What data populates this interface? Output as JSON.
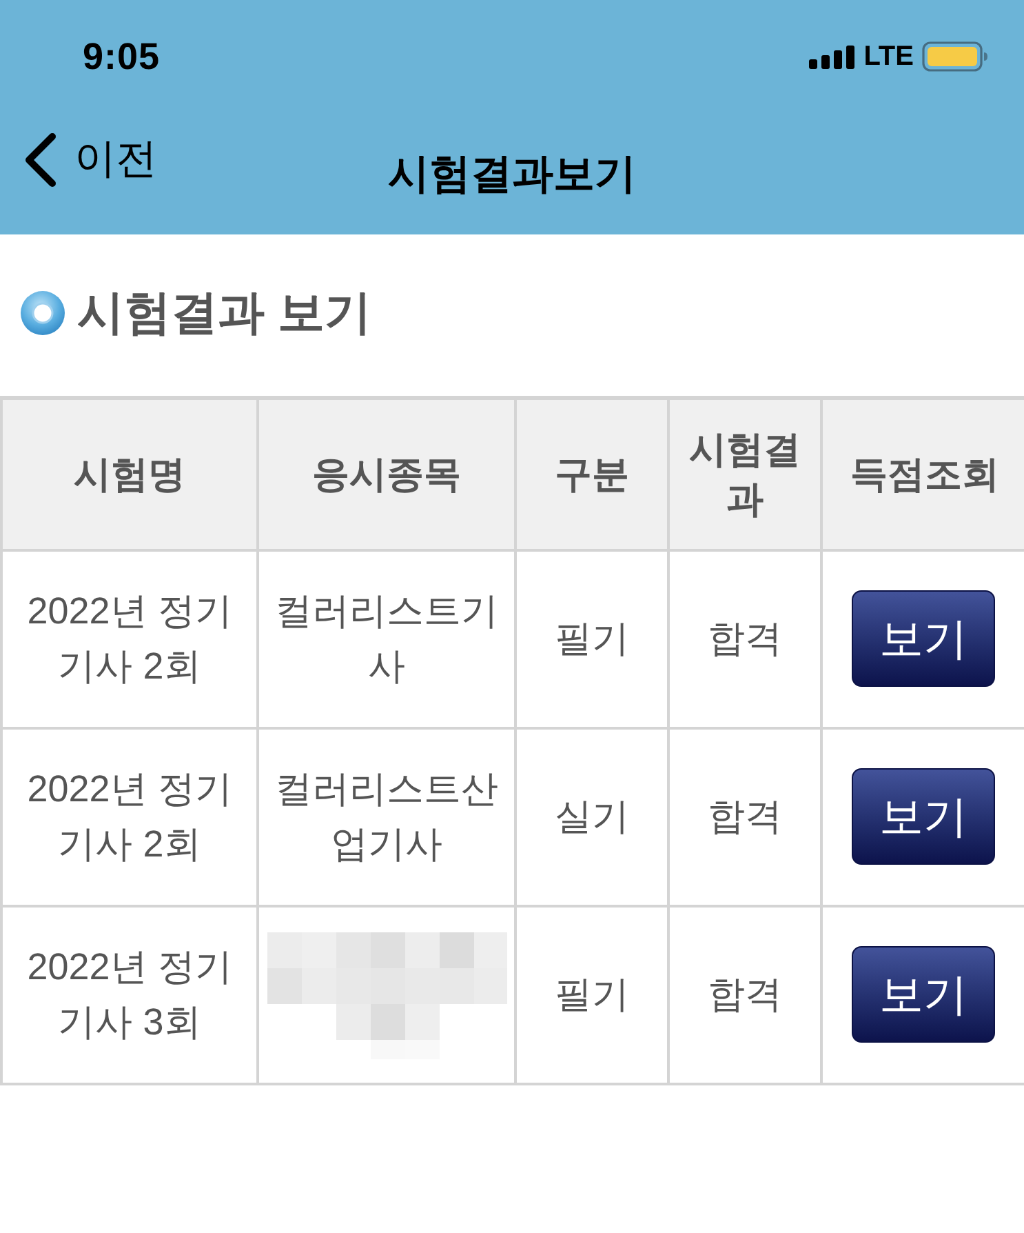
{
  "status_bar": {
    "time": "9:05",
    "network": "LTE"
  },
  "nav_bar": {
    "back_label": "이전",
    "title": "시험결과보기"
  },
  "section": {
    "title": "시험결과 보기"
  },
  "table": {
    "columns": [
      "시험명",
      "응시종목",
      "구분",
      "시험결과",
      "득점조회"
    ],
    "rows": [
      {
        "exam": "2022년 정기기사 2회",
        "subject": "컬러리스트기사",
        "type": "필기",
        "result": "합격",
        "action": "보기",
        "redacted": false
      },
      {
        "exam": "2022년 정기기사 2회",
        "subject": "컬러리스트산업기사",
        "type": "실기",
        "result": "합격",
        "action": "보기",
        "redacted": false
      },
      {
        "exam": "2022년 정기기사 3회",
        "type": "필기",
        "result": "합격",
        "action": "보기",
        "redacted": true
      }
    ]
  }
}
